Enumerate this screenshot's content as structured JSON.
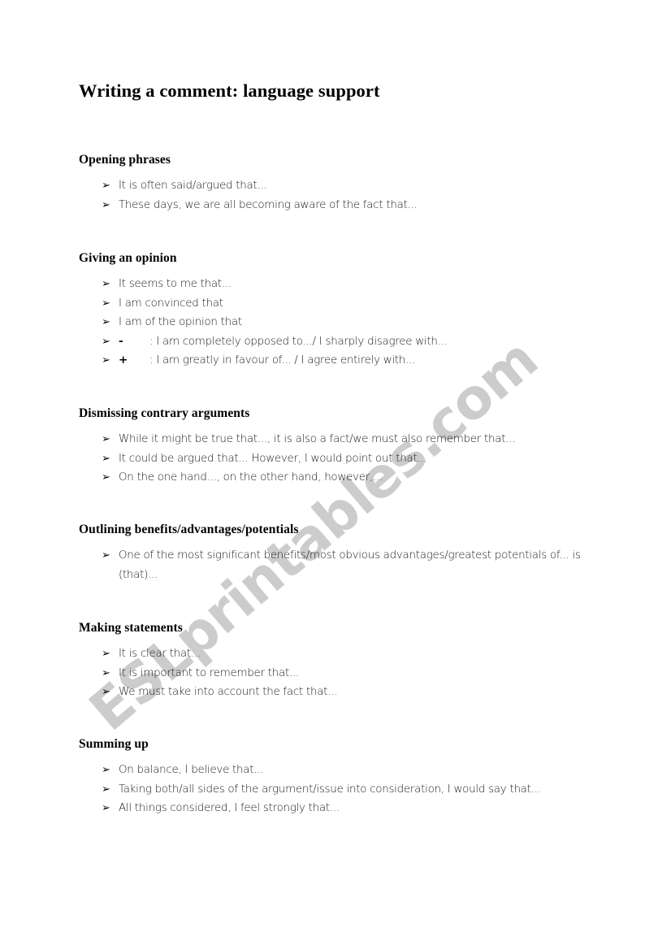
{
  "document": {
    "title": "Writing a comment: language support",
    "watermark": "ESLprintables.com",
    "watermark_color": "#cccccc"
  },
  "sections": [
    {
      "heading": "Opening phrases",
      "items": [
        {
          "text": "It is often said/argued that..."
        },
        {
          "text": "These days, we are all becoming aware of the fact that..."
        }
      ]
    },
    {
      "heading": "Giving an opinion",
      "items": [
        {
          "text": "It seems to me that..."
        },
        {
          "text": "I am convinced that"
        },
        {
          "text": "I am of the opinion that"
        },
        {
          "sign": "-",
          "text": ": I am completely opposed to.../ I sharply disagree with..."
        },
        {
          "sign": "+",
          "text": ": I am greatly in favour of... / I agree entirely with..."
        }
      ]
    },
    {
      "heading": "Dismissing contrary arguments",
      "items": [
        {
          "text": "While it might be true that..., it is also a fact/we must also remember that..."
        },
        {
          "text": "It could be argued that... However, I would point out that..."
        },
        {
          "text": "On the one hand..., on the other hand, however,..."
        }
      ]
    },
    {
      "heading": "Outlining benefits/advantages/potentials",
      "items": [
        {
          "text": "One of the most significant benefits/most obvious advantages/greatest potentials of... is (that)..."
        }
      ]
    },
    {
      "heading": "Making statements",
      "items": [
        {
          "text": "It is clear that..."
        },
        {
          "text": "It is important to remember that..."
        },
        {
          "text": "We must take into account the fact that..."
        }
      ]
    },
    {
      "heading": "Summing up",
      "items": [
        {
          "text": "On balance, I believe that..."
        },
        {
          "text": "Taking both/all sides of the argument/issue into consideration, I would say that..."
        },
        {
          "text": "All things considered, I feel strongly that..."
        }
      ]
    }
  ],
  "bullet_glyph": "➢",
  "layout": {
    "section_tops": [
      188,
      309,
      500,
      643,
      764,
      907
    ]
  }
}
